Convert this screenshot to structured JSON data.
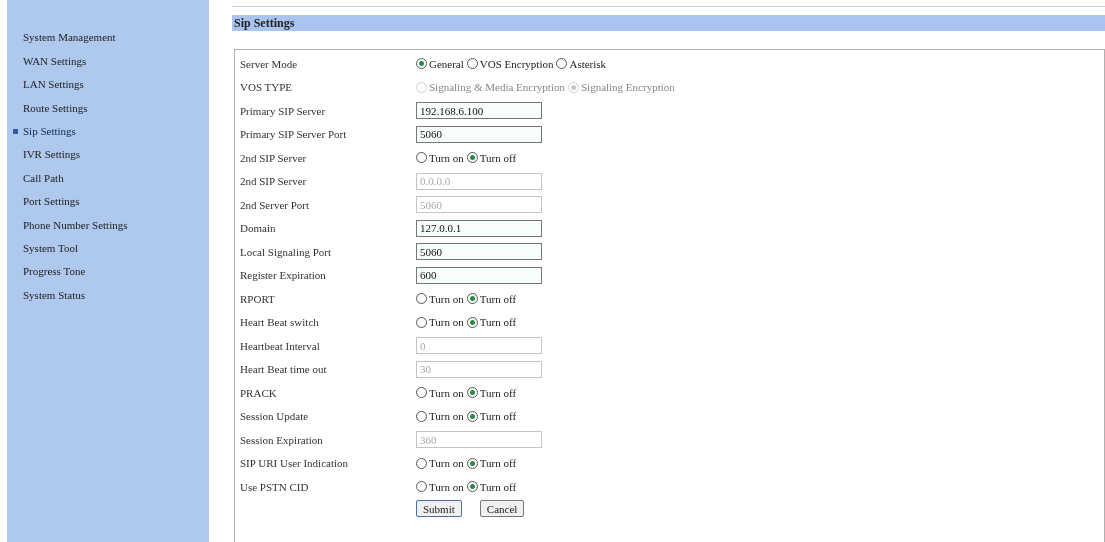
{
  "sidebar": {
    "items": [
      {
        "label": "System Management",
        "selected": false
      },
      {
        "label": "WAN Settings",
        "selected": false
      },
      {
        "label": "LAN Settings",
        "selected": false
      },
      {
        "label": "Route Settings",
        "selected": false
      },
      {
        "label": "Sip Settings",
        "selected": true
      },
      {
        "label": "IVR Settings",
        "selected": false
      },
      {
        "label": "Call Path",
        "selected": false
      },
      {
        "label": "Port Settings",
        "selected": false
      },
      {
        "label": "Phone Number Settings",
        "selected": false
      },
      {
        "label": "System Tool",
        "selected": false
      },
      {
        "label": "Progress Tone",
        "selected": false
      },
      {
        "label": "System Status",
        "selected": false
      }
    ]
  },
  "section_title": "Sip Settings",
  "form": {
    "rows": [
      {
        "label": "Server Mode",
        "kind": "radio",
        "disabled": false,
        "options": [
          {
            "label": "General",
            "selected": true
          },
          {
            "label": "VOS Encryption",
            "selected": false
          },
          {
            "label": "Asterisk",
            "selected": false
          }
        ]
      },
      {
        "label": "VOS TYPE",
        "kind": "radio",
        "disabled": true,
        "options": [
          {
            "label": "Signaling & Media Encryption",
            "selected": false
          },
          {
            "label": "Signaling Encryption",
            "selected": true
          }
        ]
      },
      {
        "label": "Primary SIP Server",
        "kind": "input",
        "disabled": false,
        "value": "192.168.6.100"
      },
      {
        "label": "Primary SIP Server Port",
        "kind": "input",
        "disabled": false,
        "value": "5060"
      },
      {
        "label": "2nd SIP Server",
        "kind": "radio",
        "disabled": false,
        "options": [
          {
            "label": "Turn on",
            "selected": false
          },
          {
            "label": "Turn off",
            "selected": true
          }
        ]
      },
      {
        "label": "2nd SIP Server",
        "kind": "input",
        "disabled": true,
        "value": "0.0.0.0"
      },
      {
        "label": "2nd Server Port",
        "kind": "input",
        "disabled": true,
        "value": "5060"
      },
      {
        "label": "Domain",
        "kind": "input",
        "disabled": false,
        "value": "127.0.0.1"
      },
      {
        "label": "Local Signaling Port",
        "kind": "input",
        "disabled": false,
        "value": "5060"
      },
      {
        "label": "Register Expiration",
        "kind": "input",
        "disabled": false,
        "value": "600"
      },
      {
        "label": "RPORT",
        "kind": "radio",
        "disabled": false,
        "options": [
          {
            "label": "Turn on",
            "selected": false
          },
          {
            "label": "Turn off",
            "selected": true
          }
        ]
      },
      {
        "label": "Heart Beat switch",
        "kind": "radio",
        "disabled": false,
        "options": [
          {
            "label": "Turn on",
            "selected": false
          },
          {
            "label": "Turn off",
            "selected": true
          }
        ]
      },
      {
        "label": "Heartbeat Interval",
        "kind": "input",
        "disabled": true,
        "value": "0"
      },
      {
        "label": "Heart Beat time out",
        "kind": "input",
        "disabled": true,
        "value": "30"
      },
      {
        "label": "PRACK",
        "kind": "radio",
        "disabled": false,
        "options": [
          {
            "label": "Turn on",
            "selected": false
          },
          {
            "label": "Turn off",
            "selected": true
          }
        ]
      },
      {
        "label": "Session Update",
        "kind": "radio",
        "disabled": false,
        "options": [
          {
            "label": "Turn on",
            "selected": false
          },
          {
            "label": "Turn off",
            "selected": true
          }
        ]
      },
      {
        "label": "Session Expiration",
        "kind": "input",
        "disabled": true,
        "value": "360"
      },
      {
        "label": "SIP URI User Indication",
        "kind": "radio",
        "disabled": false,
        "options": [
          {
            "label": "Turn on",
            "selected": false
          },
          {
            "label": "Turn off",
            "selected": true
          }
        ]
      },
      {
        "label": "Use PSTN CID",
        "kind": "radio",
        "disabled": false,
        "options": [
          {
            "label": "Turn on",
            "selected": false
          },
          {
            "label": "Turn off",
            "selected": true
          }
        ]
      }
    ],
    "buttons": [
      "Submit",
      "Cancel"
    ]
  }
}
